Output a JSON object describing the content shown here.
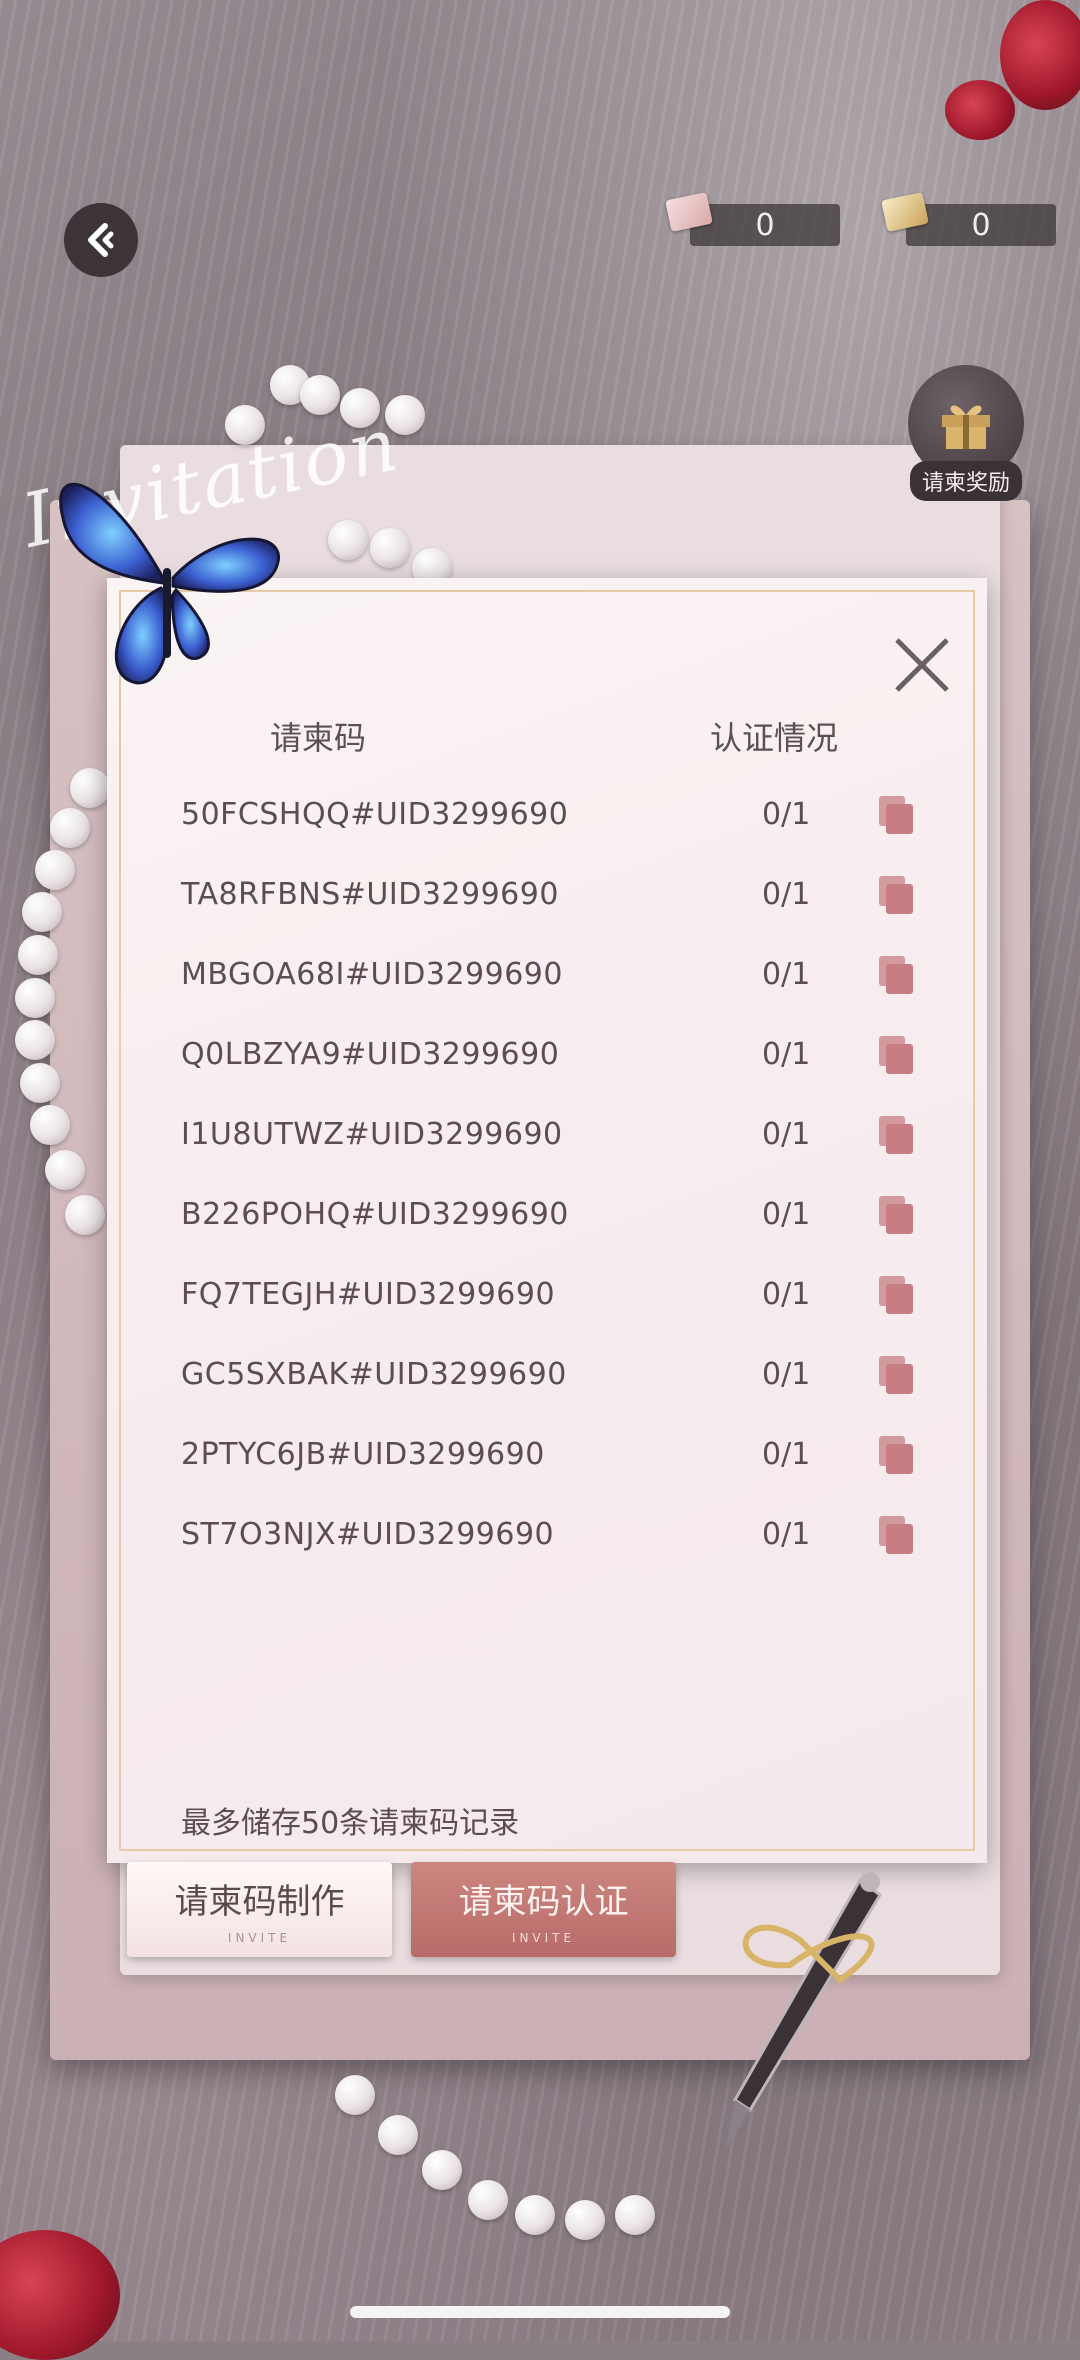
{
  "top_bar": {
    "currency_1": {
      "icon": "envelope-pink-icon",
      "value": "0"
    },
    "currency_2": {
      "icon": "envelope-gold-icon",
      "value": "0"
    }
  },
  "reward": {
    "label": "请柬奖励",
    "icon": "gift-icon"
  },
  "modal": {
    "columns": {
      "code": "请柬码",
      "status": "认证情况"
    },
    "rows": [
      {
        "code": "50FCSHQQ#UID3299690",
        "status": "0/1"
      },
      {
        "code": "TA8RFBNS#UID3299690",
        "status": "0/1"
      },
      {
        "code": "MBGOA68I#UID3299690",
        "status": "0/1"
      },
      {
        "code": "Q0LBZYA9#UID3299690",
        "status": "0/1"
      },
      {
        "code": "I1U8UTWZ#UID3299690",
        "status": "0/1"
      },
      {
        "code": "B226POHQ#UID3299690",
        "status": "0/1"
      },
      {
        "code": "FQ7TEGJH#UID3299690",
        "status": "0/1"
      },
      {
        "code": "GC5SXBAK#UID3299690",
        "status": "0/1"
      },
      {
        "code": "2PTYC6JB#UID3299690",
        "status": "0/1"
      },
      {
        "code": "ST7O3NJX#UID3299690",
        "status": "0/1"
      }
    ],
    "footnote": "最多储存50条请柬码记录"
  },
  "buttons": {
    "make": {
      "label": "请柬码制作",
      "sub": "INVITE"
    },
    "verify": {
      "label": "请柬码认证",
      "sub": "INVITE"
    }
  },
  "decor": {
    "script_word": "Invitation"
  },
  "colors": {
    "accent": "#c77d81",
    "text": "#5b4d51",
    "panel": "#f7ecee"
  }
}
